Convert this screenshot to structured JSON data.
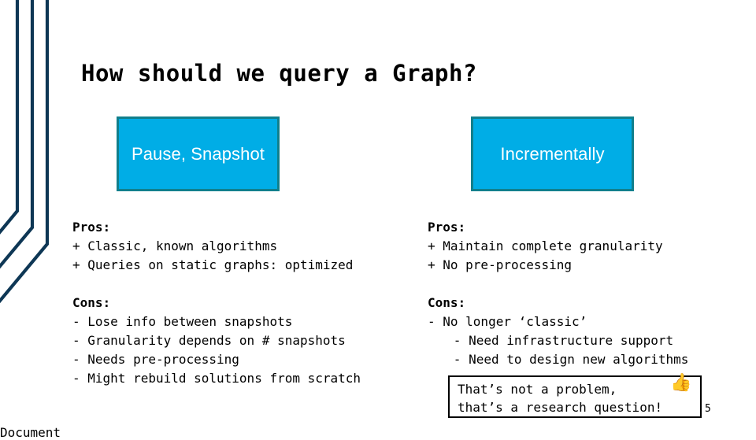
{
  "slide": {
    "title": "How should we query a Graph?",
    "page_number": "5",
    "colors": {
      "accent_fill": "#00ade6",
      "accent_border": "#117f8c",
      "deco_navy": "#0e3755",
      "text": "#000000"
    }
  },
  "options": [
    {
      "heading": "Pause, Snapshot",
      "pros_label": "Pros:",
      "pros": [
        "+ Classic, known algorithms",
        "+ Queries on static graphs: optimized"
      ],
      "cons_label": "Cons:",
      "cons": [
        {
          "text": "- Lose info between snapshots",
          "sub": false
        },
        {
          "text": "- Granularity depends on # snapshots",
          "sub": false
        },
        {
          "text": "- Needs pre-processing",
          "sub": false
        },
        {
          "text": "- Might rebuild solutions from scratch",
          "sub": false
        }
      ]
    },
    {
      "heading": "Incrementally",
      "pros_label": "Pros:",
      "pros": [
        "+ Maintain complete granularity",
        "+ No pre-processing"
      ],
      "cons_label": "Cons:",
      "cons": [
        {
          "text": "- No longer ‘classic’",
          "sub": false
        },
        {
          "text": "- Need infrastructure support",
          "sub": true
        },
        {
          "text": "- Need to design new algorithms",
          "sub": true
        }
      ]
    }
  ],
  "callout": {
    "line1": "That’s not a problem,",
    "line2": "that’s a research question!",
    "icon": "thumbs-up-icon",
    "icon_glyph": "👍"
  }
}
